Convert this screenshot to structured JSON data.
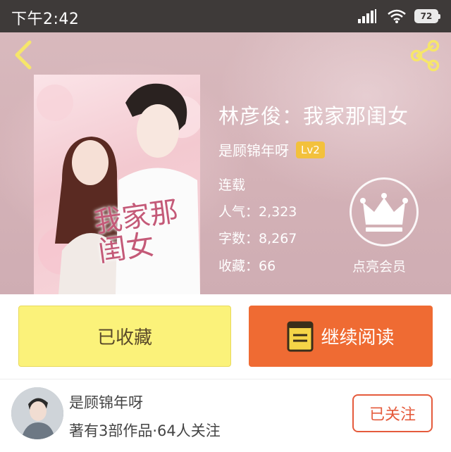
{
  "status_bar": {
    "time": "下午2:42",
    "battery": "72"
  },
  "book": {
    "title": "林彦俊：我家那闺女",
    "author": "是顾锦年呀",
    "author_level": "Lv2",
    "status": "连载",
    "popularity": "人气：2,323",
    "word_count": "字数：8,267",
    "favorites": "收藏：66",
    "cover_art_text": "我家那闺女"
  },
  "vip": {
    "label": "点亮会员",
    "icon": "crown-icon"
  },
  "actions": {
    "collected_label": "已收藏",
    "read_label": "继续阅读",
    "read_icon": "book-icon"
  },
  "writer": {
    "name": "是顾锦年呀",
    "meta": "著有3部作品·64人关注",
    "follow_label": "已关注"
  },
  "colors": {
    "status_bar_bg": "#3e3a39",
    "hero_bg": "#d5b3b8",
    "badge": "#f3c13c",
    "collected_bg": "#fbf27a",
    "read_bg": "#ef6b33",
    "follow_border": "#e55b3c"
  }
}
